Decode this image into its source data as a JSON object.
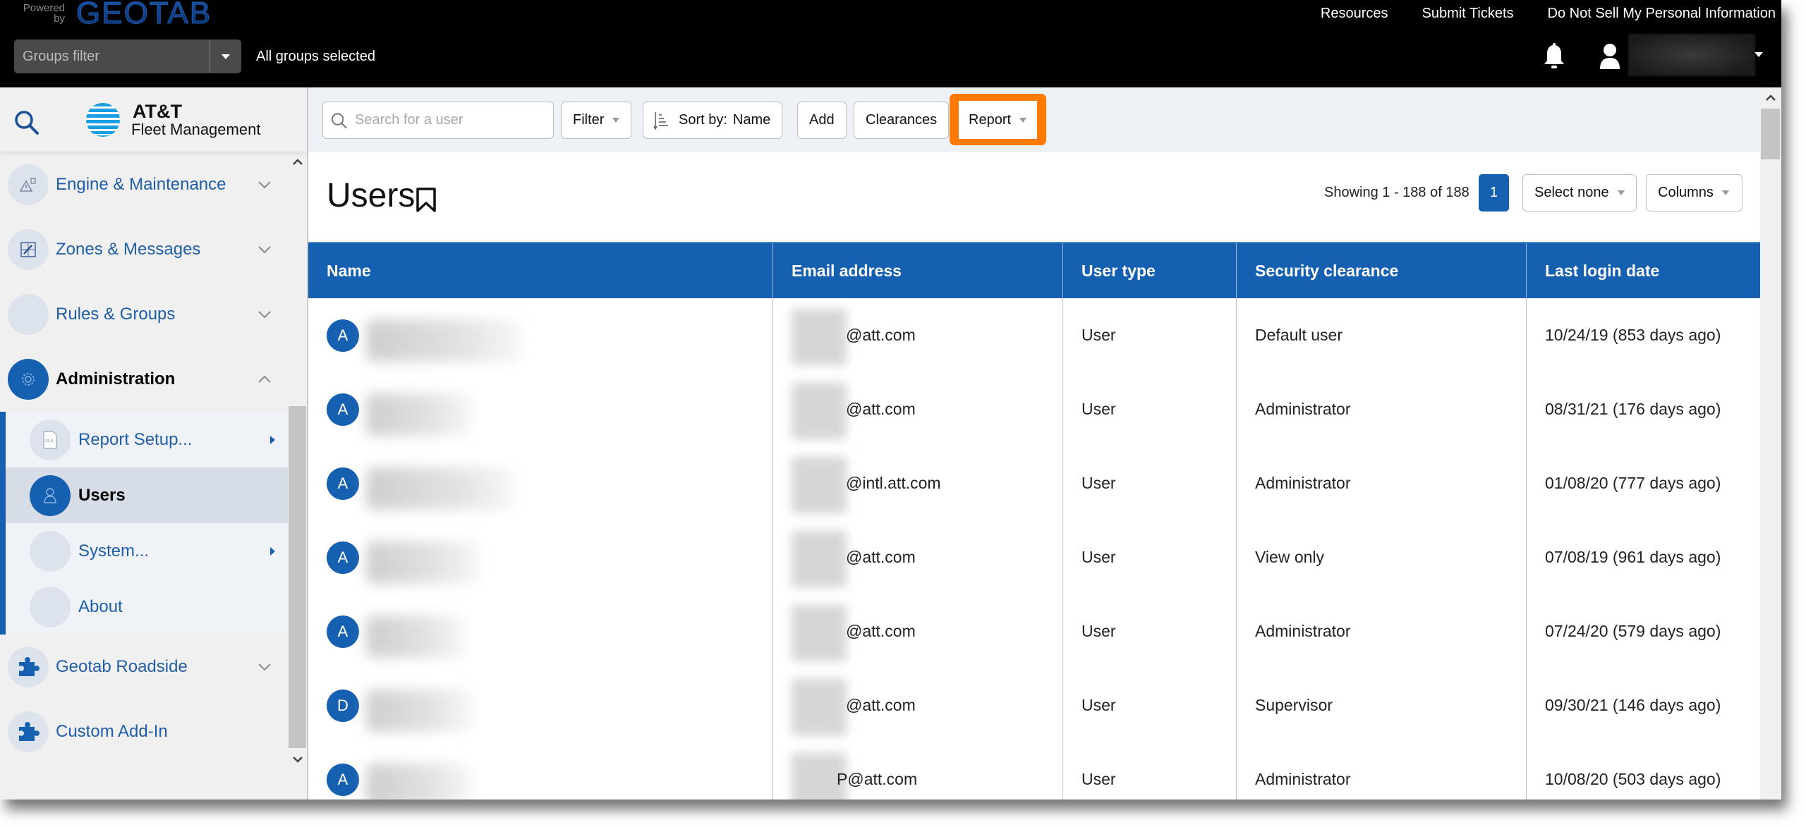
{
  "topbar": {
    "powered_by": "Powered by",
    "logo": "GEOTAB",
    "groups_filter_placeholder": "Groups filter",
    "groups_status": "All groups selected",
    "links": [
      "Resources",
      "Submit Tickets",
      "Do Not Sell My Personal Information"
    ]
  },
  "sidebar": {
    "brand_title": "AT&T",
    "brand_subtitle": "Fleet Management",
    "items": [
      {
        "label": "Engine & Maintenance",
        "icon": "engine-warning-icon",
        "state": "collapsed"
      },
      {
        "label": "Zones & Messages",
        "icon": "map-edit-icon",
        "state": "collapsed"
      },
      {
        "label": "Rules & Groups",
        "icon": "rules-icon",
        "state": "collapsed"
      },
      {
        "label": "Administration",
        "icon": "gear-icon",
        "state": "expanded"
      },
      {
        "label": "Geotab Roadside",
        "icon": "puzzle-icon",
        "state": "collapsed"
      },
      {
        "label": "Custom Add-In",
        "icon": "puzzle-icon",
        "state": "none"
      }
    ],
    "admin_subitems": [
      {
        "label": "Report Setup...",
        "icon": "xls-file-icon",
        "has_submenu": true
      },
      {
        "label": "Users",
        "icon": "user-icon",
        "selected": true
      },
      {
        "label": "System...",
        "icon": "",
        "has_submenu": true
      },
      {
        "label": "About",
        "icon": ""
      }
    ]
  },
  "toolbar": {
    "search_placeholder": "Search for a user",
    "search_value": "",
    "filter_label": "Filter",
    "sort_prefix": "Sort by:",
    "sort_value": "Name",
    "add_label": "Add",
    "clearances_label": "Clearances",
    "report_label": "Report",
    "highlight_color": "#ff7a00"
  },
  "page": {
    "title": "Users",
    "showing": "Showing 1 - 188 of 188",
    "current_page": "1",
    "select_none_label": "Select none",
    "columns_label": "Columns"
  },
  "table": {
    "columns": [
      "Name",
      "Email address",
      "User type",
      "Security clearance",
      "Last login date"
    ],
    "rows": [
      {
        "initial": "A",
        "email": "@att.com",
        "type": "User",
        "clearance": "Default user",
        "last_login": "10/24/19 (853 days ago)"
      },
      {
        "initial": "A",
        "email": "@att.com",
        "type": "User",
        "clearance": "Administrator",
        "last_login": "08/31/21 (176 days ago)"
      },
      {
        "initial": "A",
        "email": "@intl.att.com",
        "type": "User",
        "clearance": "Administrator",
        "last_login": "01/08/20 (777 days ago)"
      },
      {
        "initial": "A",
        "email": "@att.com",
        "type": "User",
        "clearance": "View only",
        "last_login": "07/08/19 (961 days ago)"
      },
      {
        "initial": "A",
        "email": "@att.com",
        "type": "User",
        "clearance": "Administrator",
        "last_login": "07/24/20 (579 days ago)"
      },
      {
        "initial": "D",
        "email": "@att.com",
        "type": "User",
        "clearance": "Supervisor",
        "last_login": "09/30/21 (146 days ago)"
      },
      {
        "initial": "A",
        "email": "P@att.com",
        "type": "User",
        "clearance": "Administrator",
        "last_login": "10/08/20 (503 days ago)"
      }
    ]
  },
  "colors": {
    "brand_blue": "#1560b0",
    "topbar_bg": "#000000",
    "sidebar_bg": "#f0f0f0",
    "toolbar_bg": "#eef1f6"
  }
}
